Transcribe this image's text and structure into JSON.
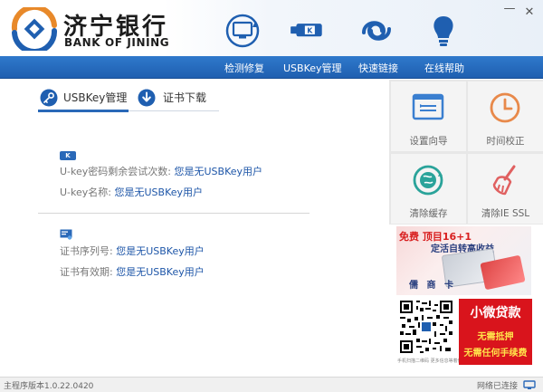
{
  "window": {
    "minimize_glyph": "—",
    "close_glyph": "✕"
  },
  "brand": {
    "name_cn": "济宁银行",
    "name_en": "BANK OF JINING"
  },
  "top_icons": [
    "monitor-refresh-icon",
    "usb-key-icon",
    "link-loop-icon",
    "lightbulb-icon"
  ],
  "nav": {
    "items": [
      {
        "label": "检测修复"
      },
      {
        "label": "USBKey管理"
      },
      {
        "label": "快速链接"
      },
      {
        "label": "在线帮助"
      }
    ]
  },
  "tabs": [
    {
      "label": "USBKey管理",
      "active": true,
      "icon": "key-icon"
    },
    {
      "label": "证书下载",
      "active": false,
      "icon": "download-icon"
    }
  ],
  "ukey": {
    "badge": "K",
    "retry_label": "U-key密码剩余尝试次数:",
    "retry_value": "您是无USBKey用户",
    "name_label": "U-key名称:",
    "name_value": "您是无USBKey用户"
  },
  "cert": {
    "serial_label": "证书序列号:",
    "serial_value": "您是无USBKey用户",
    "validity_label": "证书有效期:",
    "validity_value": "您是无USBKey用户"
  },
  "tools": [
    {
      "label": "设置向导",
      "icon": "wizard-icon"
    },
    {
      "label": "时间校正",
      "icon": "clock-icon"
    },
    {
      "label": "清除缓存",
      "icon": "globe-refresh-icon"
    },
    {
      "label": "清除IE SSL",
      "icon": "broom-icon"
    }
  ],
  "ads": {
    "ad1_line1": "免费 顶目16+1",
    "ad1_line2": "定活自转高收益",
    "ad1_bottom": "儒 商 卡",
    "qr_caption": "手机扫描二维码 更多信息等着你",
    "ad2_title": "小微贷款",
    "ad2_line1": "无需抵押",
    "ad2_line2": "无需任何手续费"
  },
  "status": {
    "version": "主程序版本1.0.22.0420",
    "connection": "网络已连接"
  },
  "colors": {
    "nav_blue": "#2370c4",
    "link_blue": "#1e56a8",
    "ad_red": "#d9141c"
  }
}
